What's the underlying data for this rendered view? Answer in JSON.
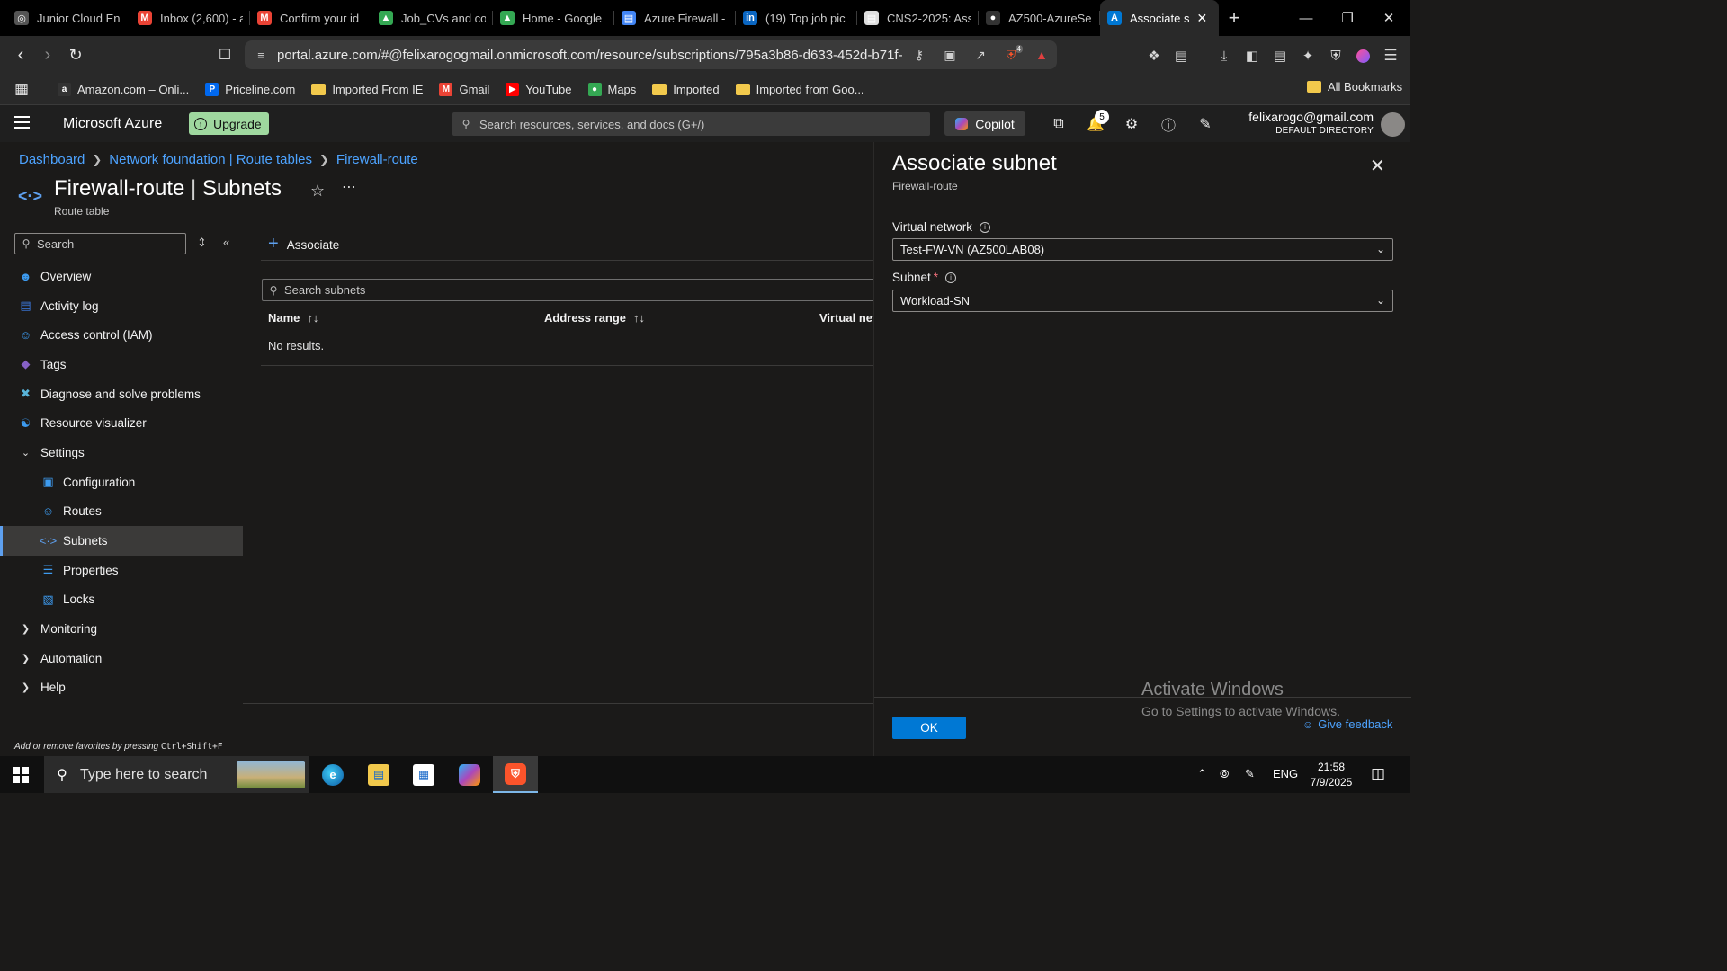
{
  "browser": {
    "tabs": [
      {
        "title": "Junior Cloud En",
        "fav": "globe-icon",
        "color": "#555555"
      },
      {
        "title": "Inbox (2,600) - a",
        "fav": "gmail-icon",
        "color": "#ea4335"
      },
      {
        "title": "Confirm your id",
        "fav": "gmail-icon",
        "color": "#ea4335"
      },
      {
        "title": "Job_CVs and co",
        "fav": "drive-icon",
        "color": "#34a853"
      },
      {
        "title": "Home - Google",
        "fav": "drive-icon",
        "color": "#34a853"
      },
      {
        "title": "Azure Firewall -",
        "fav": "docs-icon",
        "color": "#4285f4"
      },
      {
        "title": "(19) Top job pic",
        "fav": "linkedin-icon",
        "color": "#0a66c2"
      },
      {
        "title": "CNS2-2025: Ass",
        "fav": "page-icon",
        "color": "#dddddd"
      },
      {
        "title": "AZ500-AzureSe",
        "fav": "github-icon",
        "color": "#333333"
      },
      {
        "title": "Associate s",
        "fav": "azure-icon",
        "color": "#0078d4",
        "active": true
      }
    ],
    "url": "portal.azure.com/#@felixarogogmail.onmicrosoft.com/resource/subscriptions/795a3b86-d633-452d-b71f-...",
    "brave_badge": "4",
    "bookmarks": [
      {
        "label": "Amazon.com – Onli...",
        "fav": "amazon-icon",
        "color": "#333333"
      },
      {
        "label": "Priceline.com",
        "fav": "priceline-icon",
        "color": "#0068ef"
      },
      {
        "label": "Imported From IE",
        "fav": "folder-icon",
        "color": "#f2c94c"
      },
      {
        "label": "Gmail",
        "fav": "gmail-icon",
        "color": "#ea4335"
      },
      {
        "label": "YouTube",
        "fav": "youtube-icon",
        "color": "#ff0000"
      },
      {
        "label": "Maps",
        "fav": "maps-icon",
        "color": "#34a853"
      },
      {
        "label": "Imported",
        "fav": "folder-icon",
        "color": "#f2c94c"
      },
      {
        "label": "Imported from Goo...",
        "fav": "folder-icon",
        "color": "#f2c94c"
      }
    ],
    "all_bookmarks": "All Bookmarks"
  },
  "azure": {
    "brand": "Microsoft Azure",
    "upgrade": "Upgrade",
    "search_placeholder": "Search resources, services, and docs (G+/)",
    "copilot": "Copilot",
    "notifications": "5",
    "account_email": "felixarogo@gmail.com",
    "account_directory": "DEFAULT DIRECTORY"
  },
  "breadcrumb": [
    "Dashboard",
    "Network foundation | Route tables",
    "Firewall-route"
  ],
  "page": {
    "title_main": "Firewall-route",
    "title_section": "Subnets",
    "subtitle": "Route table",
    "menu_search_placeholder": "Search",
    "favorites_hint_prefix": "Add or remove favorites by pressing ",
    "favorites_hint_keys": "Ctrl+Shift+F"
  },
  "nav": [
    {
      "label": "Overview",
      "icon": "overview-icon",
      "color": "#3d9bf0",
      "level": 0
    },
    {
      "label": "Activity log",
      "icon": "activity-log-icon",
      "color": "#3d7ee8",
      "level": 0
    },
    {
      "label": "Access control (IAM)",
      "icon": "iam-icon",
      "color": "#3d9bf0",
      "level": 0
    },
    {
      "label": "Tags",
      "icon": "tag-icon",
      "color": "#8661c5",
      "level": 0
    },
    {
      "label": "Diagnose and solve problems",
      "icon": "wrench-icon",
      "color": "#59b4d9",
      "level": 0
    },
    {
      "label": "Resource visualizer",
      "icon": "visualizer-icon",
      "color": "#3d9bf0",
      "level": 0
    },
    {
      "label": "Settings",
      "icon": "chevron-down-icon",
      "level": 0,
      "group": true
    },
    {
      "label": "Configuration",
      "icon": "configuration-icon",
      "color": "#3d9bf0",
      "level": 1
    },
    {
      "label": "Routes",
      "icon": "routes-icon",
      "color": "#3d9bf0",
      "level": 1
    },
    {
      "label": "Subnets",
      "icon": "subnet-icon",
      "color": "#5ea0ef",
      "level": 1,
      "selected": true
    },
    {
      "label": "Properties",
      "icon": "properties-icon",
      "color": "#3d9bf0",
      "level": 1
    },
    {
      "label": "Locks",
      "icon": "lock-icon",
      "color": "#3d9bf0",
      "level": 1
    },
    {
      "label": "Monitoring",
      "icon": "chevron-right-icon",
      "level": 0,
      "group": true
    },
    {
      "label": "Automation",
      "icon": "chevron-right-icon",
      "level": 0,
      "group": true
    },
    {
      "label": "Help",
      "icon": "chevron-right-icon",
      "level": 0,
      "group": true
    }
  ],
  "content": {
    "associate_label": "Associate",
    "search_placeholder": "Search subnets",
    "columns": [
      "Name",
      "Address range",
      "Virtual net"
    ],
    "empty_text": "No results."
  },
  "pane": {
    "title": "Associate subnet",
    "subtitle": "Firewall-route",
    "vnet_label": "Virtual network",
    "vnet_value": "Test-FW-VN (AZ500LAB08)",
    "subnet_label": "Subnet",
    "subnet_required": "*",
    "subnet_value": "Workload-SN",
    "ok_label": "OK",
    "feedback_label": "Give feedback"
  },
  "watermark": {
    "line1": "Activate Windows",
    "line2": "Go to Settings to activate Windows."
  },
  "taskbar": {
    "search_placeholder": "Type here to search",
    "language": "ENG",
    "time": "21:58",
    "date": "7/9/2025"
  }
}
